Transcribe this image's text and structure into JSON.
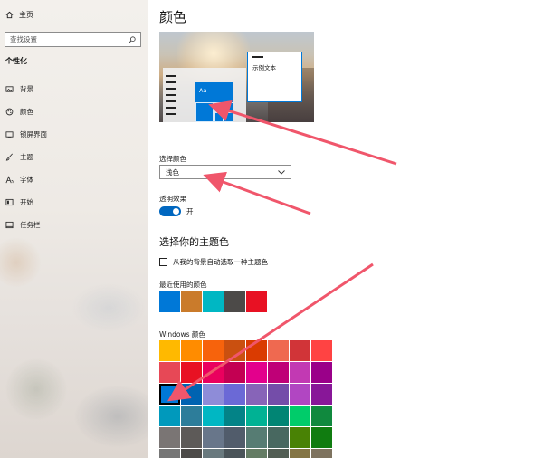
{
  "sidebar": {
    "home_label": "主页",
    "search_placeholder": "查找设置",
    "section_title": "个性化",
    "items": [
      {
        "label": "背景",
        "icon": "image-icon"
      },
      {
        "label": "颜色",
        "icon": "palette-icon"
      },
      {
        "label": "锁屏界面",
        "icon": "lock-screen-icon"
      },
      {
        "label": "主题",
        "icon": "brush-icon"
      },
      {
        "label": "字体",
        "icon": "font-icon"
      },
      {
        "label": "开始",
        "icon": "start-icon"
      },
      {
        "label": "任务栏",
        "icon": "taskbar-icon"
      }
    ]
  },
  "main": {
    "title": "颜色",
    "preview": {
      "tile_text": "Aa",
      "window_text": "示例文本"
    },
    "choose_color_label": "选择颜色",
    "choose_color_value": "浅色",
    "transparency_label": "透明效果",
    "transparency_state": "开",
    "accent_title": "选择你的主题色",
    "auto_pick_label": "从我的背景自动选取一种主题色",
    "recent_label": "最近使用的颜色",
    "recent_colors": [
      "#0078d7",
      "#ca7b2b",
      "#00b7c3",
      "#4c4a48",
      "#e81123"
    ],
    "windows_label": "Windows 颜色",
    "windows_colors": [
      [
        "#ffb900",
        "#ff8c00",
        "#f7630c",
        "#ca5010",
        "#da3b01",
        "#ef6950",
        "#d13438",
        "#ff4343"
      ],
      [
        "#e74856",
        "#e81123",
        "#ea005e",
        "#c30052",
        "#e3008c",
        "#bf0077",
        "#c239b3",
        "#9a0089"
      ],
      [
        "#0078d7",
        "#0063b1",
        "#8e8cd8",
        "#6b69d6",
        "#8764b8",
        "#744da9",
        "#b146c2",
        "#881798"
      ],
      [
        "#0099bc",
        "#2d7d9a",
        "#00b7c3",
        "#038387",
        "#00b294",
        "#018574",
        "#00cc6a",
        "#10893e"
      ],
      [
        "#7a7574",
        "#5d5a58",
        "#68768a",
        "#515c6b",
        "#567c73",
        "#486860",
        "#498205",
        "#107c10"
      ],
      [
        "#767676",
        "#4c4a48",
        "#69797e",
        "#4a5459",
        "#647c64",
        "#525e54",
        "#847545",
        "#7e735f"
      ]
    ],
    "selected_color": "#0078d7",
    "colors": {
      "accent": "#0078d7",
      "annotation_arrow": "#f0566b"
    }
  }
}
